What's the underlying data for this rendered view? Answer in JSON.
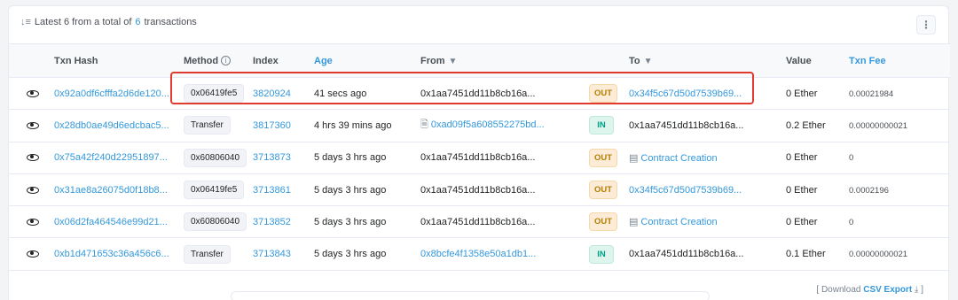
{
  "header": {
    "summary_prefix": "Latest 6 from a total of",
    "summary_count": "6",
    "summary_suffix": "transactions",
    "more_label": "⋮"
  },
  "columns": {
    "txn_hash": "Txn Hash",
    "method": "Method",
    "index": "Index",
    "age": "Age",
    "from": "From",
    "to": "To",
    "value": "Value",
    "txn_fee": "Txn Fee"
  },
  "rows": [
    {
      "hash": "0x92a0df6cfffa2d6de120...",
      "method": "0x06419fe5",
      "index": "3820924",
      "age": "41 secs ago",
      "from": "0x1aa7451dd11b8cb16a...",
      "from_link": false,
      "from_doc": false,
      "dir": "OUT",
      "to": "0x34f5c67d50d7539b69...",
      "to_link": true,
      "to_contract": false,
      "value": "0 Ether",
      "fee": "0.00021984"
    },
    {
      "hash": "0x28db0ae49d6edcbac5...",
      "method": "Transfer",
      "index": "3817360",
      "age": "4 hrs 39 mins ago",
      "from": "0xad09f5a608552275bd...",
      "from_link": true,
      "from_doc": true,
      "dir": "IN",
      "to": "0x1aa7451dd11b8cb16a...",
      "to_link": false,
      "to_contract": false,
      "value": "0.2 Ether",
      "fee": "0.00000000021"
    },
    {
      "hash": "0x75a42f240d22951897...",
      "method": "0x60806040",
      "index": "3713873",
      "age": "5 days 3 hrs ago",
      "from": "0x1aa7451dd11b8cb16a...",
      "from_link": false,
      "from_doc": false,
      "dir": "OUT",
      "to": "Contract Creation",
      "to_link": true,
      "to_contract": true,
      "value": "0 Ether",
      "fee": "0"
    },
    {
      "hash": "0x31ae8a26075d0f18b8...",
      "method": "0x06419fe5",
      "index": "3713861",
      "age": "5 days 3 hrs ago",
      "from": "0x1aa7451dd11b8cb16a...",
      "from_link": false,
      "from_doc": false,
      "dir": "OUT",
      "to": "0x34f5c67d50d7539b69...",
      "to_link": true,
      "to_contract": false,
      "value": "0 Ether",
      "fee": "0.0002196"
    },
    {
      "hash": "0x06d2fa464546e99d21...",
      "method": "0x60806040",
      "index": "3713852",
      "age": "5 days 3 hrs ago",
      "from": "0x1aa7451dd11b8cb16a...",
      "from_link": false,
      "from_doc": false,
      "dir": "OUT",
      "to": "Contract Creation",
      "to_link": true,
      "to_contract": true,
      "value": "0 Ether",
      "fee": "0"
    },
    {
      "hash": "0xb1d471653c36a456c6...",
      "method": "Transfer",
      "index": "3713843",
      "age": "5 days 3 hrs ago",
      "from": "0x8bcfe4f1358e50a1db1...",
      "from_link": true,
      "from_doc": false,
      "dir": "IN",
      "to": "0x1aa7451dd11b8cb16a...",
      "to_link": false,
      "to_contract": false,
      "value": "0.1 Ether",
      "fee": "0.00000000021"
    }
  ],
  "footer": {
    "open": "[ Download",
    "csv": "CSV Export",
    "close": "]"
  },
  "colors": {
    "link": "#3498db",
    "highlight": "#e03a2f",
    "out_badge": "#fcecd7",
    "in_badge": "#def5ee"
  }
}
